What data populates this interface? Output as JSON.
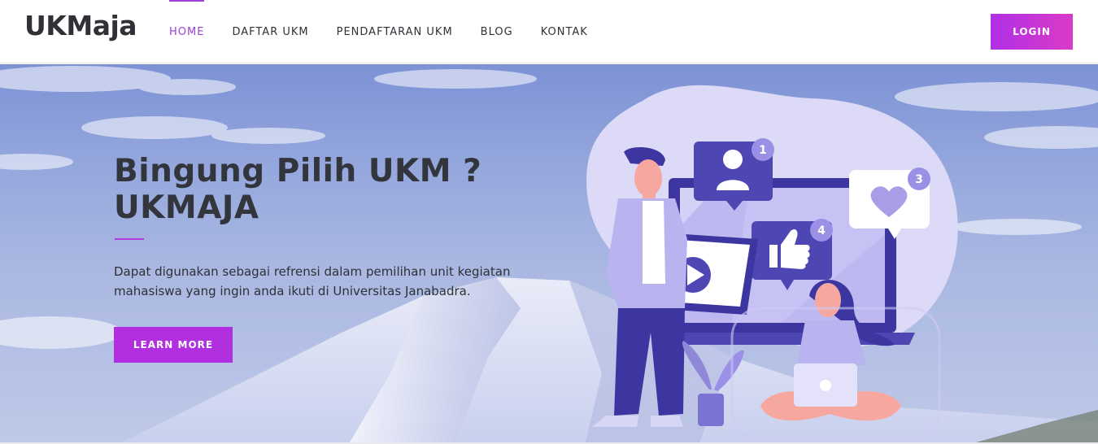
{
  "header": {
    "logo": "UKMaja",
    "nav": [
      {
        "label": "HOME",
        "active": true
      },
      {
        "label": "DAFTAR UKM",
        "active": false
      },
      {
        "label": "PENDAFTARAN UKM",
        "active": false
      },
      {
        "label": "BLOG",
        "active": false
      },
      {
        "label": "KONTAK",
        "active": false
      }
    ],
    "login_label": "LOGIN"
  },
  "hero": {
    "title_line1": "Bingung Pilih UKM ?",
    "title_line2": "UKMAJA",
    "description": "Dapat digunakan sebagai refrensi dalam pemilihan unit kegiatan mahasiswa yang ingin anda ikuti di Universitas Janabadra.",
    "button_label": "LEARN MORE"
  },
  "illustration": {
    "badges": [
      "1",
      "3",
      "4"
    ],
    "icons": [
      "user-icon",
      "heart-icon",
      "thumbs-up-icon",
      "play-icon"
    ]
  },
  "colors": {
    "accent": "#b22fe0",
    "nav_active": "#9b3fd6",
    "text_dark": "#2f3137",
    "illustration_primary": "#4e47b3",
    "illustration_light": "#d6d4f5"
  }
}
